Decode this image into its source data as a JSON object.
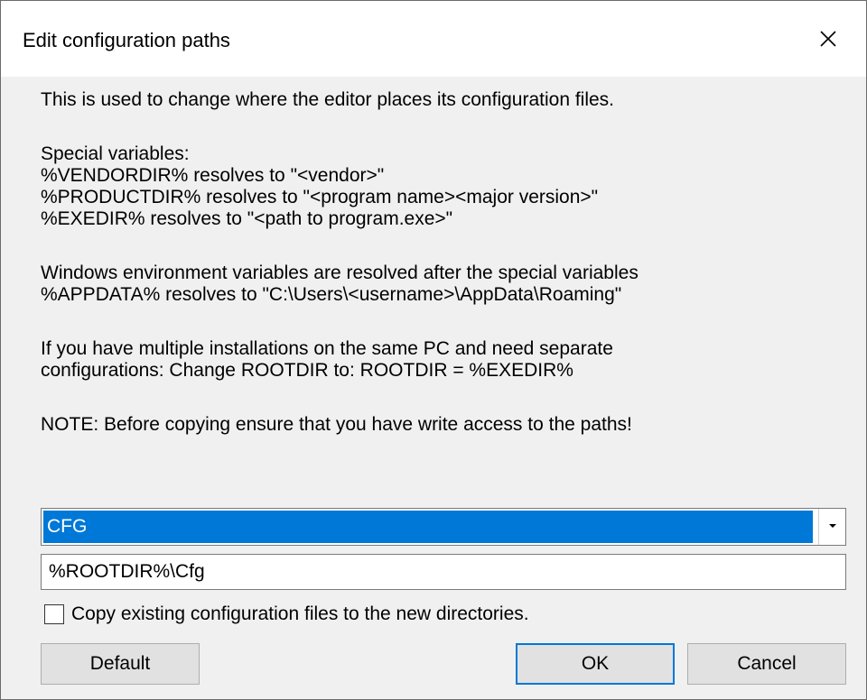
{
  "window": {
    "title": "Edit configuration paths",
    "close_icon": "close-icon"
  },
  "description": {
    "intro": "This is used to change where the editor places its configuration files.",
    "special_heading": "Special variables:",
    "vendordir": "%VENDORDIR% resolves to \"<vendor>\"",
    "productdir": "%PRODUCTDIR% resolves to \"<program name><major version>\"",
    "exedir": "%EXEDIR% resolves to \"<path to program.exe>\"",
    "env_note": "Windows environment variables are resolved after the special variables",
    "appdata": "%APPDATA% resolves to \"C:\\Users\\<username>\\AppData\\Roaming\"",
    "multi_line1": "If you have multiple installations on the same PC and need separate",
    "multi_line2": "configurations: Change ROOTDIR to: ROOTDIR = %EXEDIR%",
    "note": "NOTE: Before copying ensure that you have write access to the paths!"
  },
  "path_selector": {
    "selected": "CFG",
    "arrow_icon": "chevron-down-icon"
  },
  "path_input": {
    "value": "%ROOTDIR%\\Cfg"
  },
  "copy_option": {
    "label": "Copy existing configuration files to the new directories.",
    "checked": false
  },
  "buttons": {
    "default": "Default",
    "ok": "OK",
    "cancel": "Cancel"
  },
  "colors": {
    "selection": "#0078d7",
    "dialog_bg": "#f0f0f0",
    "button_bg": "#e1e1e1"
  }
}
